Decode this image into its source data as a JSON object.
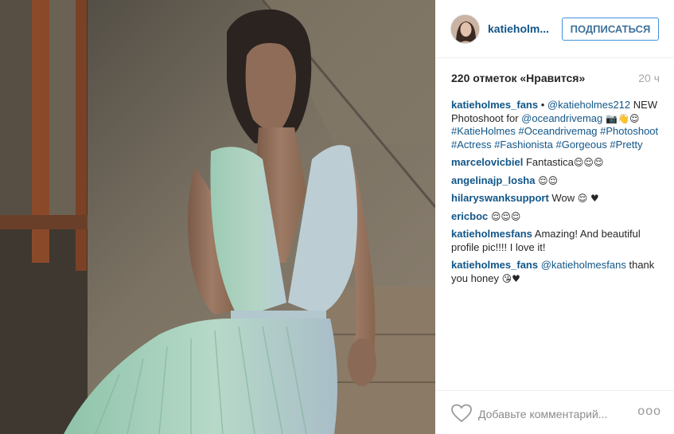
{
  "post": {
    "image_alt": "Woman in a plunging pastel pleated dress sitting by a weathered window",
    "colors": {
      "dress_mint": "#a9d2bd",
      "dress_blue": "#b9cdd6",
      "wall": "#6f6556",
      "frame": "#8a4a2a"
    }
  },
  "header": {
    "username": "katieholm...",
    "follow_label": "ПОДПИСАТЬСЯ"
  },
  "stats": {
    "likes": "220 отметок «Нравится»",
    "time": "20 ч"
  },
  "comments": [
    {
      "user": "katieholmes_fans",
      "sep": " • ",
      "mention": "@katieholmes212",
      "text1": " NEW Photoshoot for ",
      "mention2": "@oceandrivemag",
      "emoji": " 📷👋😌",
      "tags": "#KatieHolmes #Oceandrivemag #Photoshoot #Actress #Fashionista #Gorgeous #Pretty"
    },
    {
      "user": "marcelovicbiel",
      "text": " Fantastica",
      "emoji": "😌😌😌"
    },
    {
      "user": "angelinajp_losha",
      "text": " ",
      "emoji": "😌😌"
    },
    {
      "user": "hilaryswanksupport",
      "text": " Wow ",
      "emoji": "😌 ♥"
    },
    {
      "user": "ericboc",
      "text": " ",
      "emoji": "😌😌😌"
    },
    {
      "user": "katieholmesfans",
      "text": " Amazing! And beautiful profile pic!!!! I love it!"
    },
    {
      "user": "katieholmes_fans",
      "mention": " @katieholmesfans",
      "text": " thank you honey ",
      "emoji": "😘♥"
    }
  ],
  "footer": {
    "placeholder": "Добавьте комментарий...",
    "more": "ooo"
  }
}
